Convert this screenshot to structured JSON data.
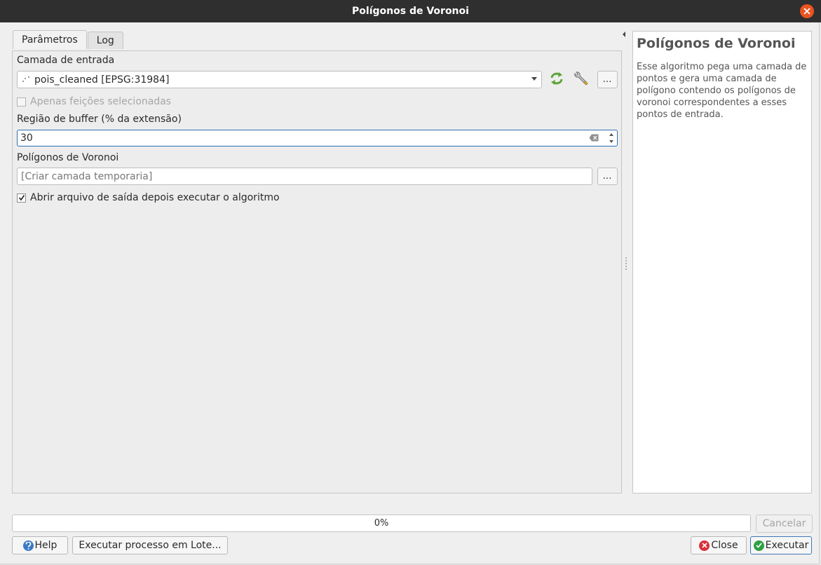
{
  "window": {
    "title": "Polígonos de Voronoi"
  },
  "tabs": [
    {
      "label": "Parâmetros",
      "active": true
    },
    {
      "label": "Log",
      "active": false
    }
  ],
  "params": {
    "input_layer_label": "Camada de entrada",
    "input_layer_value": "pois_cleaned [EPSG:31984]",
    "selected_only_label": "Apenas feições selecionadas",
    "selected_only_checked": false,
    "buffer_label": "Região de buffer (% da extensão)",
    "buffer_value": "30",
    "output_label": "Polígonos de Voronoi",
    "output_placeholder": "[Criar camada temporaria]",
    "open_after_label": "Abrir arquivo de saída depois executar o algoritmo",
    "open_after_checked": true,
    "ellipsis": "…"
  },
  "help": {
    "title": "Polígonos de Voronoi",
    "description": "Esse algoritmo pega uma camada de pontos e gera uma camada de polígono contendo os polígonos de voronoi correspondentes a esses pontos de entrada."
  },
  "progress": {
    "text": "0%",
    "value": 0
  },
  "buttons": {
    "cancel": "Cancelar",
    "help": "Help",
    "batch": "Executar processo em Lote...",
    "close": "Close",
    "run": "Executar"
  },
  "colors": {
    "titlebar": "#2f2f2f",
    "close": "#e95420",
    "focus": "#2f6fb5",
    "run_icon": "#2ea043",
    "close_icon": "#d9303a",
    "help_icon": "#3b79c4"
  }
}
